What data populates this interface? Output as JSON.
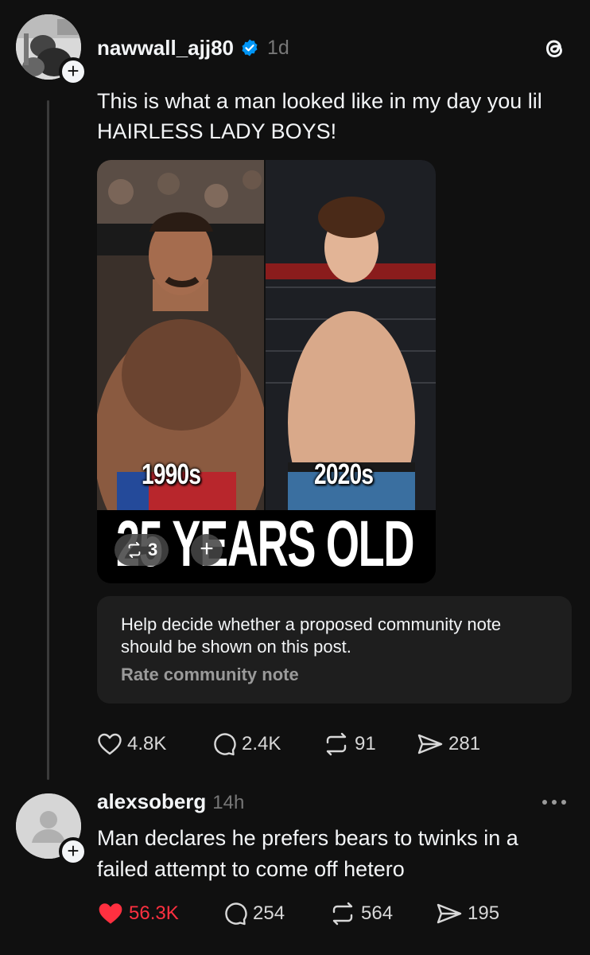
{
  "post": {
    "username": "nawwall_ajj80",
    "time": "1d",
    "verified": true,
    "text": "This is what a man looked like in my day you lil HAIRLESS LADY BOYS!",
    "media": {
      "left_label": "1990s",
      "right_label": "2020s",
      "caption": "25 YEARS OLD",
      "repost_chip_count": "3",
      "add_chip": "+"
    },
    "community_note": {
      "text": "Help decide whether a proposed community note should be shown on this post.",
      "link": "Rate community note"
    },
    "actions": {
      "likes": "4.8K",
      "replies": "2.4K",
      "reposts": "91",
      "shares": "281"
    }
  },
  "reply": {
    "username": "alexsoberg",
    "time": "14h",
    "text": "Man declares he prefers bears to twinks in a failed attempt to come off hetero",
    "actions": {
      "likes": "56.3K",
      "replies": "254",
      "reposts": "564",
      "shares": "195"
    },
    "liked": true
  },
  "colors": {
    "background": "#101010",
    "text": "#f3f5f7",
    "muted": "#777777",
    "verified": "#0095f6",
    "like_active": "#ff3040"
  }
}
